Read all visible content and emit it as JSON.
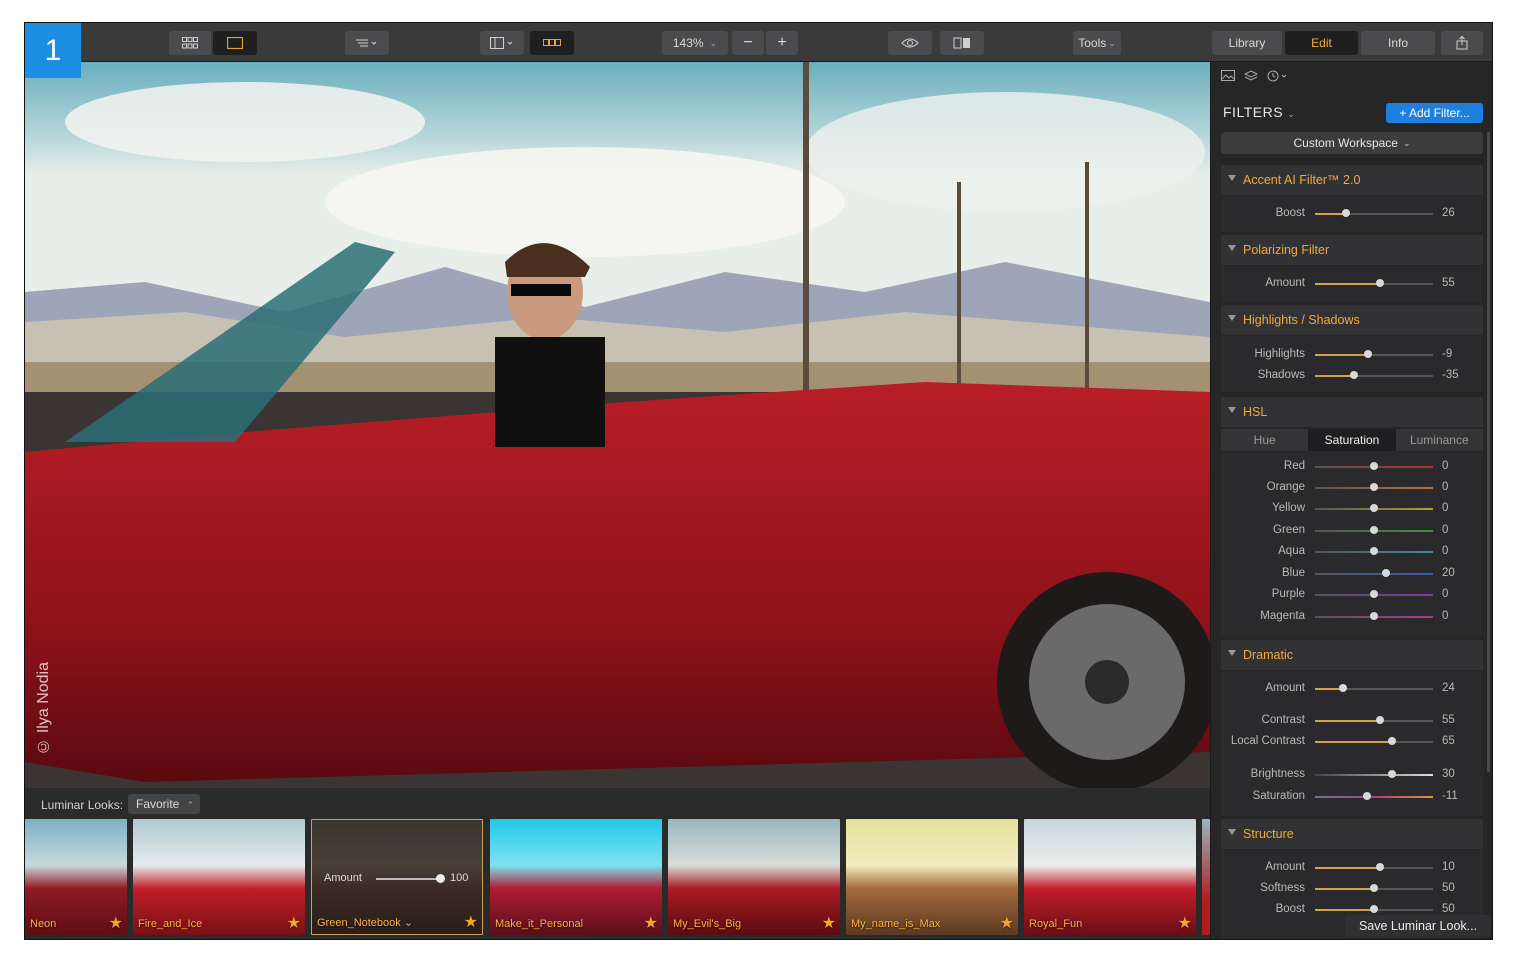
{
  "badge": "1",
  "toolbar": {
    "zoom": "143%",
    "tools_label": "Tools",
    "tabs": [
      {
        "label": "Library",
        "active": false
      },
      {
        "label": "Edit",
        "active": true
      },
      {
        "label": "Info",
        "active": false
      }
    ]
  },
  "photo": {
    "watermark": "© Ilya Nodia"
  },
  "looks": {
    "label": "Luminar Looks:",
    "category": "Favorite",
    "items": [
      {
        "name": "Neon"
      },
      {
        "name": "Fire_and_Ice"
      },
      {
        "name": "Green_Notebook",
        "selected": true,
        "amount_label": "Amount",
        "amount": "100"
      },
      {
        "name": "Make_it_Personal"
      },
      {
        "name": "My_Evil's_Big"
      },
      {
        "name": "My_name_is_Max"
      },
      {
        "name": "Royal_Fun"
      }
    ]
  },
  "panel": {
    "title": "FILTERS",
    "add_filter": "+ Add Filter...",
    "workspace": "Custom Workspace",
    "save_look": "Save Luminar Look...",
    "filters": [
      {
        "name": "Accent AI Filter™ 2.0",
        "sliders": [
          {
            "label": "Boost",
            "value": "26",
            "pos": 0.26
          }
        ]
      },
      {
        "name": "Polarizing Filter",
        "sliders": [
          {
            "label": "Amount",
            "value": "55",
            "pos": 0.55
          }
        ]
      },
      {
        "name": "Highlights / Shadows",
        "sliders": [
          {
            "label": "Highlights",
            "value": "-9",
            "pos": 0.45
          },
          {
            "label": "Shadows",
            "value": "-35",
            "pos": 0.33
          }
        ]
      },
      {
        "name": "HSL",
        "tabs": [
          {
            "label": "Hue"
          },
          {
            "label": "Saturation",
            "active": true
          },
          {
            "label": "Luminance"
          }
        ],
        "sliders": [
          {
            "label": "Red",
            "value": "0",
            "pos": 0.5
          },
          {
            "label": "Orange",
            "value": "0",
            "pos": 0.5
          },
          {
            "label": "Yellow",
            "value": "0",
            "pos": 0.5
          },
          {
            "label": "Green",
            "value": "0",
            "pos": 0.5
          },
          {
            "label": "Aqua",
            "value": "0",
            "pos": 0.5
          },
          {
            "label": "Blue",
            "value": "20",
            "pos": 0.6
          },
          {
            "label": "Purple",
            "value": "0",
            "pos": 0.5
          },
          {
            "label": "Magenta",
            "value": "0",
            "pos": 0.5
          }
        ]
      },
      {
        "name": "Dramatic",
        "sliders": [
          {
            "label": "Amount",
            "value": "24",
            "pos": 0.24
          },
          {
            "label": "Contrast",
            "value": "55",
            "pos": 0.55
          },
          {
            "label": "Local Contrast",
            "value": "65",
            "pos": 0.65
          },
          {
            "label": "Brightness",
            "value": "30",
            "pos": 0.65
          },
          {
            "label": "Saturation",
            "value": "-11",
            "pos": 0.44
          }
        ]
      },
      {
        "name": "Structure",
        "sliders": [
          {
            "label": "Amount",
            "value": "10",
            "pos": 0.55
          },
          {
            "label": "Softness",
            "value": "50",
            "pos": 0.5
          },
          {
            "label": "Boost",
            "value": "50",
            "pos": 0.5
          }
        ]
      }
    ]
  },
  "colors": {
    "accent_blue": "#1f7fe0",
    "filter_name": "#f0a93b",
    "badge": "#1d8fe3"
  }
}
